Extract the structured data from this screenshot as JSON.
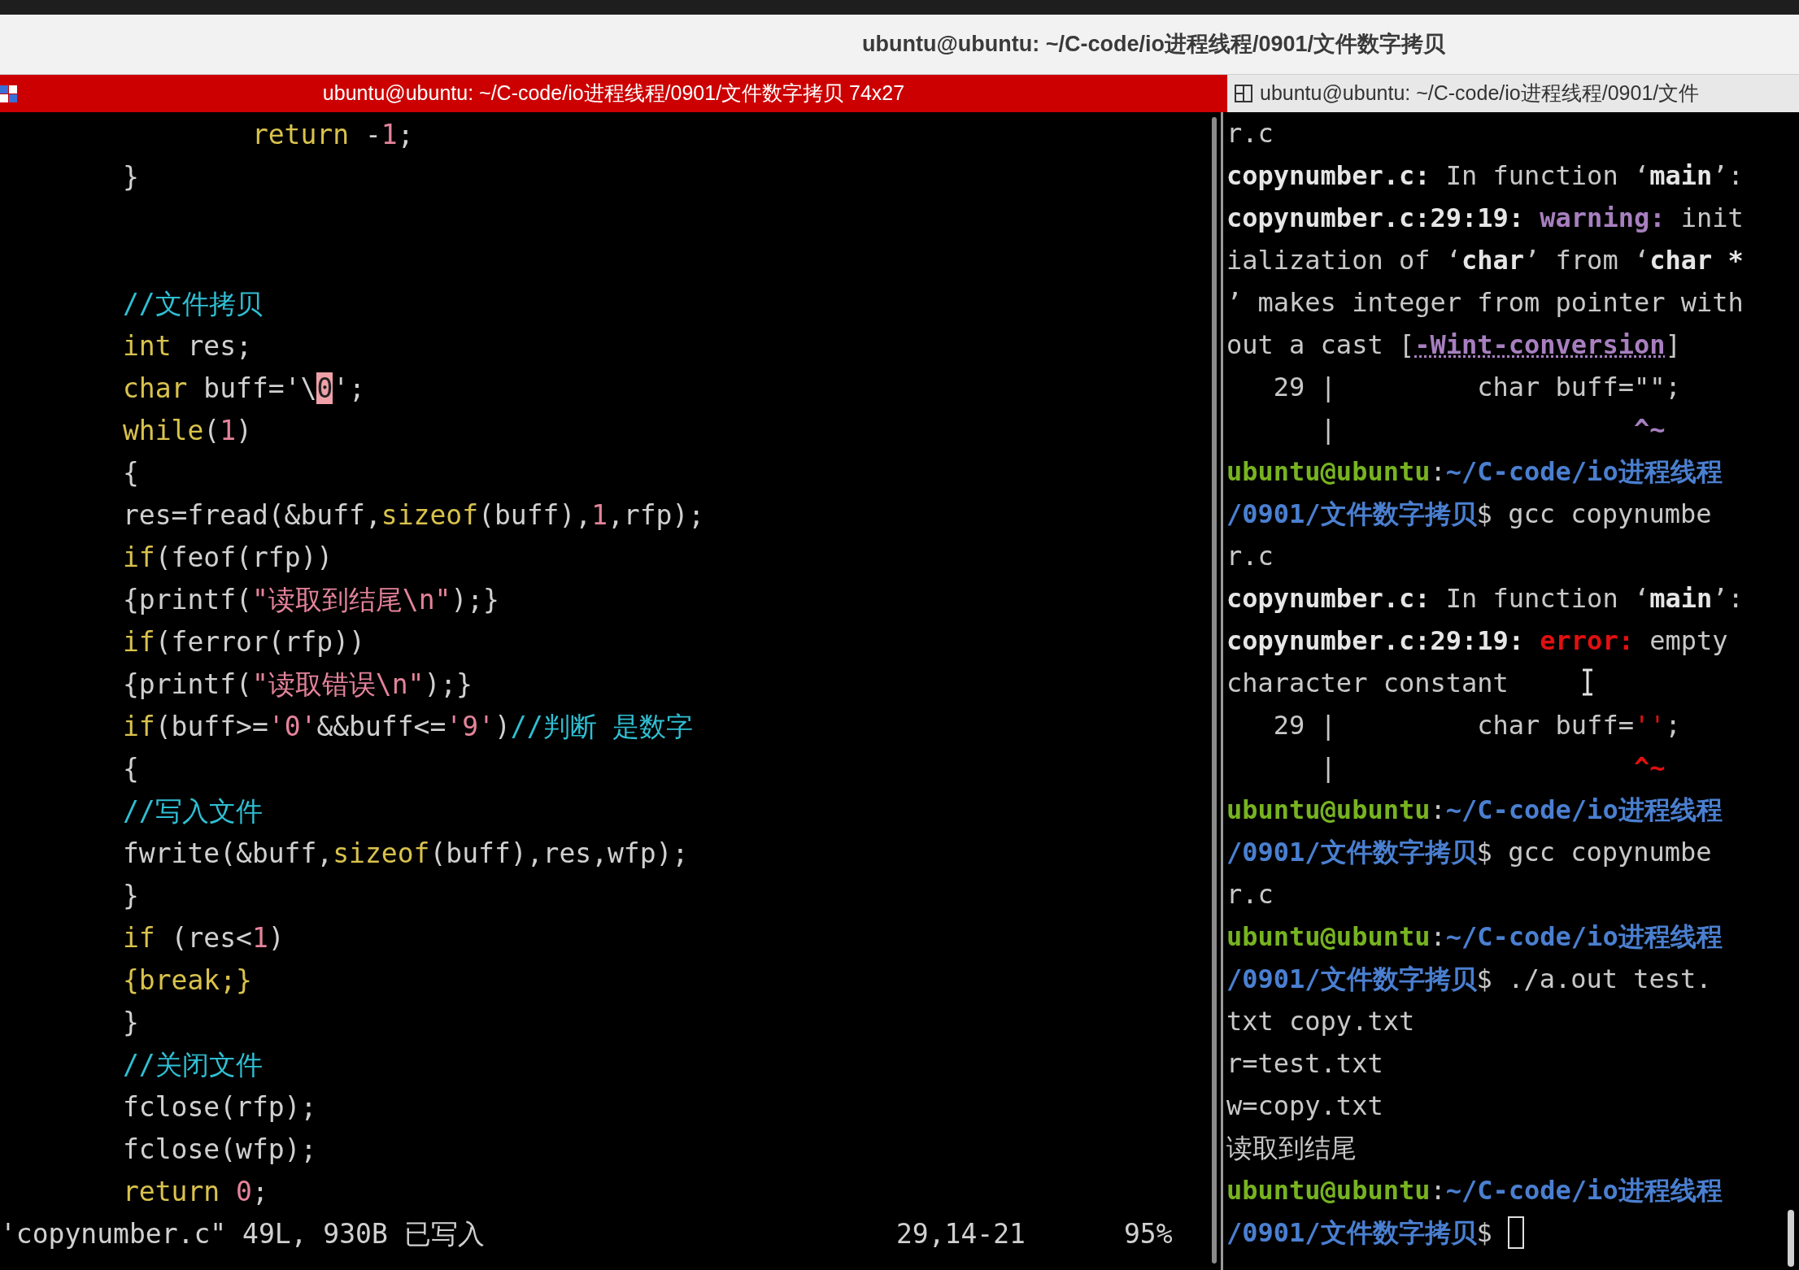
{
  "window": {
    "title": "ubuntu@ubuntu: ~/C-code/io进程线程/0901/文件数字拷贝"
  },
  "tabs": [
    {
      "label": "ubuntu@ubuntu: ~/C-code/io进程线程/0901/文件数字拷贝 74x27",
      "selected": true
    },
    {
      "label": "ubuntu@ubuntu: ~/C-code/io进程线程/0901/文件",
      "selected": false
    }
  ],
  "editor": {
    "lines": [
      {
        "kind": "code",
        "segments": [
          {
            "text": "                return",
            "kind": "keyword"
          },
          {
            "text": " -",
            "kind": "normal"
          },
          {
            "text": "1",
            "kind": "number"
          },
          {
            "text": ";",
            "kind": "normal"
          }
        ]
      },
      {
        "kind": "code",
        "segments": [
          {
            "text": "        }",
            "kind": "normal"
          }
        ]
      },
      {
        "kind": "blank"
      },
      {
        "kind": "blank"
      },
      {
        "kind": "code",
        "segments": [
          {
            "text": "        //文件拷贝",
            "kind": "comment"
          }
        ]
      },
      {
        "kind": "code",
        "segments": [
          {
            "text": "        int",
            "kind": "keyword"
          },
          {
            "text": " res;",
            "kind": "normal"
          }
        ]
      },
      {
        "kind": "code",
        "segments": [
          {
            "text": "        char",
            "kind": "keyword"
          },
          {
            "text": " buff='\\",
            "kind": "normal"
          },
          {
            "text": "0",
            "kind": "cursor"
          },
          {
            "text": "';",
            "kind": "normal"
          }
        ]
      },
      {
        "kind": "code",
        "segments": [
          {
            "text": "        while",
            "kind": "keyword"
          },
          {
            "text": "(",
            "kind": "normal"
          },
          {
            "text": "1",
            "kind": "number"
          },
          {
            "text": ")",
            "kind": "normal"
          }
        ]
      },
      {
        "kind": "code",
        "segments": [
          {
            "text": "        {",
            "kind": "normal"
          }
        ]
      },
      {
        "kind": "code",
        "segments": [
          {
            "text": "        res=fread(&buff,",
            "kind": "normal"
          },
          {
            "text": "sizeof",
            "kind": "keyword"
          },
          {
            "text": "(buff),",
            "kind": "normal"
          },
          {
            "text": "1",
            "kind": "number"
          },
          {
            "text": ",rfp);",
            "kind": "normal"
          }
        ]
      },
      {
        "kind": "code",
        "segments": [
          {
            "text": "        if",
            "kind": "keyword"
          },
          {
            "text": "(feof(rfp))",
            "kind": "normal"
          }
        ]
      },
      {
        "kind": "code",
        "segments": [
          {
            "text": "        {printf(",
            "kind": "normal"
          },
          {
            "text": "\"读取到结尾\\n\"",
            "kind": "string"
          },
          {
            "text": ");}",
            "kind": "normal"
          }
        ]
      },
      {
        "kind": "code",
        "segments": [
          {
            "text": "        if",
            "kind": "keyword"
          },
          {
            "text": "(ferror(rfp))",
            "kind": "normal"
          }
        ]
      },
      {
        "kind": "code",
        "segments": [
          {
            "text": "        {printf(",
            "kind": "normal"
          },
          {
            "text": "\"读取错误\\n\"",
            "kind": "string"
          },
          {
            "text": ");}",
            "kind": "normal"
          }
        ]
      },
      {
        "kind": "code",
        "segments": [
          {
            "text": "        if",
            "kind": "keyword"
          },
          {
            "text": "(buff>=",
            "kind": "normal"
          },
          {
            "text": "'0'",
            "kind": "string"
          },
          {
            "text": "&&buff<=",
            "kind": "normal"
          },
          {
            "text": "'9'",
            "kind": "string"
          },
          {
            "text": ")",
            "kind": "normal"
          },
          {
            "text": "//判断 是数字",
            "kind": "comment"
          }
        ]
      },
      {
        "kind": "code",
        "segments": [
          {
            "text": "        {",
            "kind": "normal"
          }
        ]
      },
      {
        "kind": "code",
        "segments": [
          {
            "text": "        //写入文件",
            "kind": "comment"
          }
        ]
      },
      {
        "kind": "code",
        "segments": [
          {
            "text": "        fwrite(&buff,",
            "kind": "normal"
          },
          {
            "text": "sizeof",
            "kind": "keyword"
          },
          {
            "text": "(buff),res,wfp);",
            "kind": "normal"
          }
        ]
      },
      {
        "kind": "code",
        "segments": [
          {
            "text": "        }",
            "kind": "normal"
          }
        ]
      },
      {
        "kind": "code",
        "segments": [
          {
            "text": "        if",
            "kind": "keyword"
          },
          {
            "text": " (res<",
            "kind": "normal"
          },
          {
            "text": "1",
            "kind": "number"
          },
          {
            "text": ")",
            "kind": "normal"
          }
        ]
      },
      {
        "kind": "code",
        "segments": [
          {
            "text": "        {break;}",
            "kind": "keyword"
          }
        ]
      },
      {
        "kind": "code",
        "segments": [
          {
            "text": "        }",
            "kind": "normal"
          }
        ]
      },
      {
        "kind": "code",
        "segments": [
          {
            "text": "        //关闭文件",
            "kind": "comment"
          }
        ]
      },
      {
        "kind": "code",
        "segments": [
          {
            "text": "        fclose(rfp);",
            "kind": "normal"
          }
        ]
      },
      {
        "kind": "code",
        "segments": [
          {
            "text": "        fclose(wfp);",
            "kind": "normal"
          }
        ]
      },
      {
        "kind": "code",
        "segments": [
          {
            "text": "        return ",
            "kind": "keyword"
          },
          {
            "text": "0",
            "kind": "number"
          },
          {
            "text": ";",
            "kind": "normal"
          }
        ]
      }
    ],
    "status": {
      "message": "'copynumber.c\" 49L, 930B 已写入",
      "position": "29,14-21",
      "percent": "95%"
    }
  },
  "terminal": {
    "lines": [
      {
        "segments": [
          {
            "text": "r.c",
            "kind": "normal"
          }
        ]
      },
      {
        "segments": [
          {
            "text": "copynumber.c:",
            "kind": "bold"
          },
          {
            "text": " In function ‘",
            "kind": "normal"
          },
          {
            "text": "main",
            "kind": "bold"
          },
          {
            "text": "’:",
            "kind": "normal"
          }
        ]
      },
      {
        "segments": [
          {
            "text": "copynumber.c:29:19: ",
            "kind": "bold"
          },
          {
            "text": "warning:",
            "kind": "warning"
          },
          {
            "text": " init",
            "kind": "normal"
          }
        ]
      },
      {
        "segments": [
          {
            "text": "ialization of ‘",
            "kind": "normal"
          },
          {
            "text": "char",
            "kind": "bold"
          },
          {
            "text": "’ from ‘",
            "kind": "normal"
          },
          {
            "text": "char *",
            "kind": "bold"
          }
        ]
      },
      {
        "segments": [
          {
            "text": "’ makes integer from pointer with",
            "kind": "normal"
          }
        ]
      },
      {
        "segments": [
          {
            "text": "out a cast [",
            "kind": "normal"
          },
          {
            "text": "-Wint-conversion",
            "kind": "link"
          },
          {
            "text": "]",
            "kind": "normal"
          }
        ]
      },
      {
        "segments": [
          {
            "text": "   29 |         char buff=\"\";",
            "kind": "normal"
          }
        ]
      },
      {
        "segments": [
          {
            "text": "      |                   ",
            "kind": "normal"
          },
          {
            "text": "^~",
            "kind": "warning"
          }
        ]
      },
      {
        "segments": [
          {
            "text": "ubuntu@ubuntu",
            "kind": "user"
          },
          {
            "text": ":",
            "kind": "normal"
          },
          {
            "text": "~/C-code/io进程线程",
            "kind": "path"
          }
        ]
      },
      {
        "segments": [
          {
            "text": "/0901/文件数字拷贝",
            "kind": "path"
          },
          {
            "text": "$ gcc copynumbe",
            "kind": "normal"
          }
        ]
      },
      {
        "segments": [
          {
            "text": "r.c",
            "kind": "normal"
          }
        ]
      },
      {
        "segments": [
          {
            "text": "copynumber.c:",
            "kind": "bold"
          },
          {
            "text": " In function ‘",
            "kind": "normal"
          },
          {
            "text": "main",
            "kind": "bold"
          },
          {
            "text": "’:",
            "kind": "normal"
          }
        ]
      },
      {
        "segments": [
          {
            "text": "copynumber.c:29:19: ",
            "kind": "bold"
          },
          {
            "text": "error:",
            "kind": "error"
          },
          {
            "text": " empty",
            "kind": "normal"
          }
        ]
      },
      {
        "segments": [
          {
            "text": "character constant",
            "kind": "normal"
          }
        ]
      },
      {
        "segments": [
          {
            "text": "   29 |         char buff=",
            "kind": "normal"
          },
          {
            "text": "''",
            "kind": "error_plain"
          },
          {
            "text": ";",
            "kind": "normal"
          }
        ]
      },
      {
        "segments": [
          {
            "text": "      |                   ",
            "kind": "normal"
          },
          {
            "text": "^~",
            "kind": "error"
          }
        ]
      },
      {
        "segments": [
          {
            "text": "ubuntu@ubuntu",
            "kind": "user"
          },
          {
            "text": ":",
            "kind": "normal"
          },
          {
            "text": "~/C-code/io进程线程",
            "kind": "path"
          }
        ]
      },
      {
        "segments": [
          {
            "text": "/0901/文件数字拷贝",
            "kind": "path"
          },
          {
            "text": "$ gcc copynumbe",
            "kind": "normal"
          }
        ]
      },
      {
        "segments": [
          {
            "text": "r.c",
            "kind": "normal"
          }
        ]
      },
      {
        "segments": [
          {
            "text": "ubuntu@ubuntu",
            "kind": "user"
          },
          {
            "text": ":",
            "kind": "normal"
          },
          {
            "text": "~/C-code/io进程线程",
            "kind": "path"
          }
        ]
      },
      {
        "segments": [
          {
            "text": "/0901/文件数字拷贝",
            "kind": "path"
          },
          {
            "text": "$ ./a.out test.",
            "kind": "normal"
          }
        ]
      },
      {
        "segments": [
          {
            "text": "txt copy.txt",
            "kind": "normal"
          }
        ]
      },
      {
        "segments": [
          {
            "text": "r=test.txt",
            "kind": "normal"
          }
        ]
      },
      {
        "segments": [
          {
            "text": "w=copy.txt",
            "kind": "normal"
          }
        ]
      },
      {
        "segments": [
          {
            "text": "读取到结尾",
            "kind": "normal"
          }
        ]
      },
      {
        "segments": [
          {
            "text": "ubuntu@ubuntu",
            "kind": "user"
          },
          {
            "text": ":",
            "kind": "normal"
          },
          {
            "text": "~/C-code/io进程线程",
            "kind": "path"
          }
        ]
      },
      {
        "segments": [
          {
            "text": "/0901/文件数字拷贝",
            "kind": "path"
          },
          {
            "text": "$ ",
            "kind": "normal"
          },
          {
            "kind": "block_cursor"
          }
        ]
      }
    ]
  }
}
